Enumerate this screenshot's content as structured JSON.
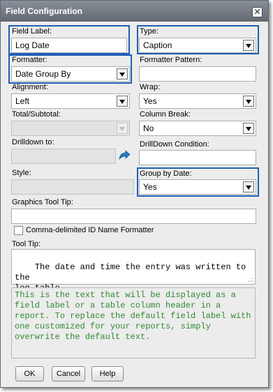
{
  "dialog": {
    "title": "Field Configuration"
  },
  "field_label": {
    "label": "Field Label:",
    "value": "Log Date"
  },
  "type": {
    "label": "Type:",
    "value": "Caption"
  },
  "formatter": {
    "label": "Formatter:",
    "value": "Date Group By"
  },
  "formatter_pattern": {
    "label": "Formatter Pattern:",
    "value": ""
  },
  "alignment": {
    "label": "Alignment:",
    "value": "Left"
  },
  "wrap": {
    "label": "Wrap:",
    "value": "Yes"
  },
  "total_subtotal": {
    "label": "Total/Subtotal:",
    "value": ""
  },
  "column_break": {
    "label": "Column Break:",
    "value": "No"
  },
  "drilldown_to": {
    "label": "Drilldown to:",
    "value": ""
  },
  "drilldown_condition": {
    "label": "DrillDown Condition:",
    "value": ""
  },
  "style": {
    "label": "Style:",
    "value": ""
  },
  "group_by_date": {
    "label": "Group by Date:",
    "value": "Yes"
  },
  "graphics_tooltip": {
    "label": "Graphics Tool Tip:",
    "value": ""
  },
  "comma_delimited": {
    "label": "Comma-delimited ID Name Formatter",
    "checked": false
  },
  "tooltip": {
    "label": "Tool Tip:",
    "value": "The date and time the entry was written to the\nlog table."
  },
  "description": "This is the text that will be displayed as a\nfield label or a table column header in a\nreport. To replace the default field label with\none customized for your reports, simply\noverwrite the default text.",
  "buttons": {
    "ok": "OK",
    "cancel": "Cancel",
    "help": "Help"
  },
  "colors": {
    "highlight": "#1f5fb4",
    "description_text": "#2e8b2e",
    "titlebar": "#6e747c"
  },
  "icons": {
    "close": "close-icon",
    "drilldown": "drilldown-arrow-icon",
    "dropdown": "chevron-down-icon"
  }
}
